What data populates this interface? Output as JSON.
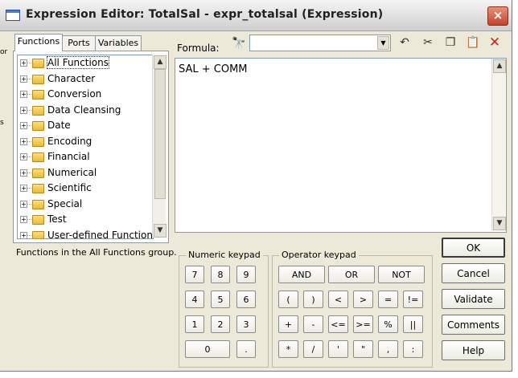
{
  "window": {
    "title": "Expression Editor: TotalSal - expr_totalsal (Expression)",
    "close_glyph": "×",
    "edge_fragments": [
      "or",
      "s"
    ]
  },
  "tabs": [
    {
      "label": "Functions",
      "active": true
    },
    {
      "label": "Ports",
      "active": false
    },
    {
      "label": "Variables",
      "active": false
    }
  ],
  "function_tree": [
    {
      "label": "All Functions",
      "selected": true
    },
    {
      "label": "Character"
    },
    {
      "label": "Conversion"
    },
    {
      "label": "Data Cleansing"
    },
    {
      "label": "Date"
    },
    {
      "label": "Encoding"
    },
    {
      "label": "Financial"
    },
    {
      "label": "Numerical"
    },
    {
      "label": "Scientific"
    },
    {
      "label": "Special"
    },
    {
      "label": "Test"
    },
    {
      "label": "User-defined Functions"
    }
  ],
  "function_description": "Functions in the All Functions group.",
  "formula": {
    "label": "Formula:",
    "text": "SAL + COMM",
    "search_value": ""
  },
  "toolbar": [
    {
      "name": "find-icon",
      "glyph": "🔭"
    },
    {
      "name": "undo-icon",
      "glyph": "↶"
    },
    {
      "name": "cut-icon",
      "glyph": "✂"
    },
    {
      "name": "copy-icon",
      "glyph": "❐"
    },
    {
      "name": "paste-icon",
      "glyph": "📋"
    },
    {
      "name": "delete-icon",
      "glyph": "✕"
    }
  ],
  "numeric_keypad": {
    "title": "Numeric keypad",
    "rows": [
      [
        "7",
        "8",
        "9"
      ],
      [
        "4",
        "5",
        "6"
      ],
      [
        "1",
        "2",
        "3"
      ],
      [
        "0",
        "."
      ]
    ]
  },
  "operator_keypad": {
    "title": "Operator keypad",
    "logic_row": [
      "AND",
      "OR",
      "NOT"
    ],
    "rows": [
      [
        "(",
        ")",
        "<",
        ">",
        "=",
        "!="
      ],
      [
        "+",
        "-",
        "<=",
        ">=",
        "%",
        "||"
      ],
      [
        "*",
        "/",
        "'",
        "\"",
        ",",
        ":"
      ]
    ]
  },
  "actions": [
    "OK",
    "Cancel",
    "Validate",
    "Comments",
    "Help"
  ]
}
